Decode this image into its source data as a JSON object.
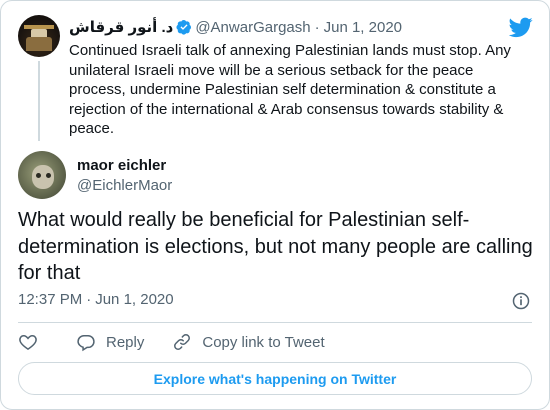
{
  "parent_tweet": {
    "name": "د. أنور قرقاش",
    "handle": "@AnwarGargash",
    "date": "Jun 1, 2020",
    "text": "Continued Israeli talk of annexing Palestinian lands must stop.  Any unilateral Israeli move will be a serious setback for the peace process, undermine Palestinian self determination & constitute a rejection of the international & Arab consensus towards stability & peace."
  },
  "reply_tweet": {
    "name": "maor eichler",
    "handle": "@EichlerMaor",
    "text": "What would really be beneficial for Palestinian self-determination is elections, but not many people are calling for that",
    "time": "12:37 PM",
    "date": "Jun 1, 2020"
  },
  "actions": {
    "reply_label": "Reply",
    "copy_link_label": "Copy link to Tweet"
  },
  "explore_button": "Explore what's happening on Twitter",
  "colors": {
    "accent": "#1d9bf0",
    "text": "#0f1419",
    "muted": "#536471",
    "border": "#cfd9de"
  },
  "icons": [
    "twitter-bird-icon",
    "verified-badge-icon",
    "info-icon",
    "heart-icon",
    "reply-icon",
    "link-icon"
  ]
}
